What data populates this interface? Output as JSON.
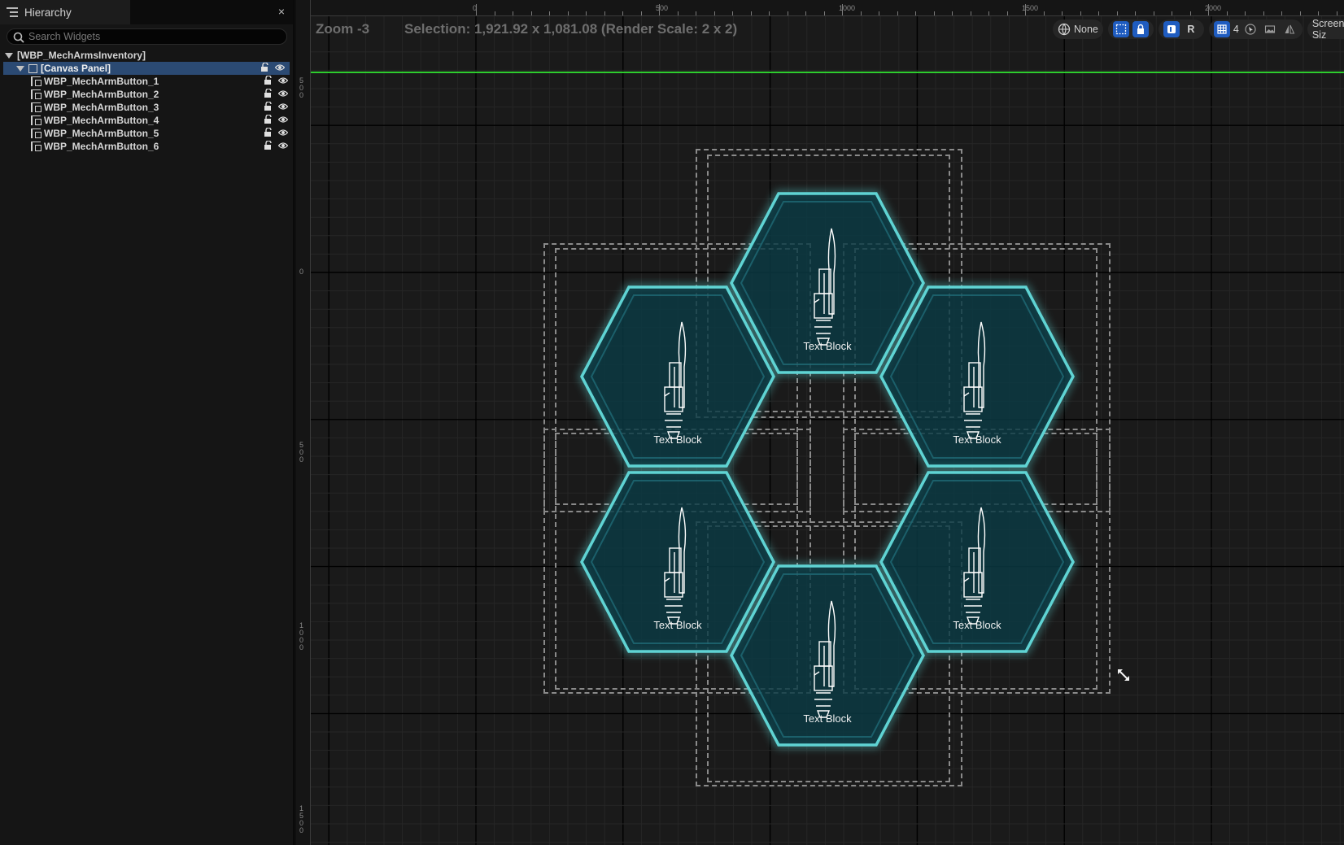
{
  "hierarchy": {
    "tab_title": "Hierarchy",
    "close_glyph": "×",
    "search_placeholder": "Search Widgets",
    "root": "[WBP_MechArmsInventory]",
    "canvas": "[Canvas Panel]",
    "children": [
      "WBP_MechArmButton_1",
      "WBP_MechArmButton_2",
      "WBP_MechArmButton_3",
      "WBP_MechArmButton_4",
      "WBP_MechArmButton_5",
      "WBP_MechArmButton_6"
    ]
  },
  "viewport": {
    "zoom": "Zoom -3",
    "selection": "Selection: 1,921.92 x 1,081.08 (Render Scale: 2 x 2)",
    "ruler_top": [
      "0",
      "500",
      "1000",
      "1500",
      "2000"
    ],
    "ruler_left": [
      "5\n0\n0",
      "0",
      "5\n0\n0",
      "1\n0\n0\n0",
      "1\n5\n0\n0"
    ],
    "toolbar": {
      "localization": "None",
      "grid_size": "4",
      "r_label": "R",
      "screen_size": "Screen Siz"
    },
    "accent_color": "#5fd3d3",
    "selection_color": "#1f5cc0",
    "guide_color": "#2ecc2e"
  },
  "widgets": [
    {
      "label": "Text Block"
    },
    {
      "label": "Text Block"
    },
    {
      "label": "Text Block"
    },
    {
      "label": "Text Block"
    },
    {
      "label": "Text Block"
    },
    {
      "label": "Text Block"
    }
  ],
  "icons": {
    "hierarchy_tab": "list-icon",
    "search": "search-icon",
    "lock": "lock-icon",
    "visibility": "eye-icon",
    "localization": "globe-icon",
    "resize": "resize-arrows-icon"
  }
}
